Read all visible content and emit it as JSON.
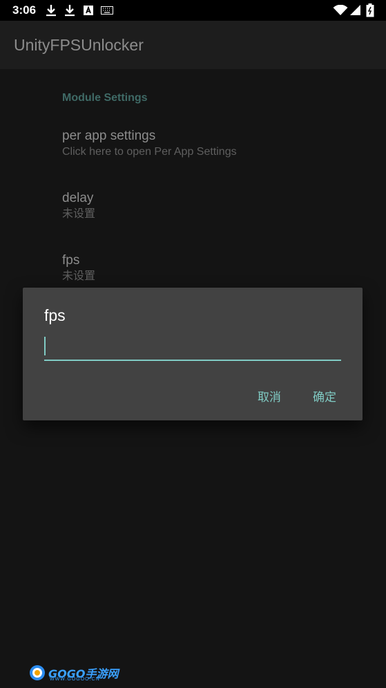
{
  "status_bar": {
    "time": "3:06",
    "icons": [
      "download-icon",
      "download-icon",
      "a-box-icon",
      "keyboard-icon",
      "wifi-icon",
      "signal-icon",
      "battery-icon"
    ]
  },
  "app_bar": {
    "title": "UnityFPSUnlocker"
  },
  "settings": {
    "category": "Module Settings",
    "items": [
      {
        "title": "per app settings",
        "summary": "Click here to open Per App Settings"
      },
      {
        "title": "delay",
        "summary": "未设置"
      },
      {
        "title": "fps",
        "summary": "未设置"
      }
    ]
  },
  "dialog": {
    "title": "fps",
    "input_value": "",
    "cancel_label": "取消",
    "ok_label": "确定",
    "accent": "#80cbc4"
  },
  "watermark": {
    "brand": "GOGO手游网",
    "url": "WWW.GOGOO.CN"
  }
}
